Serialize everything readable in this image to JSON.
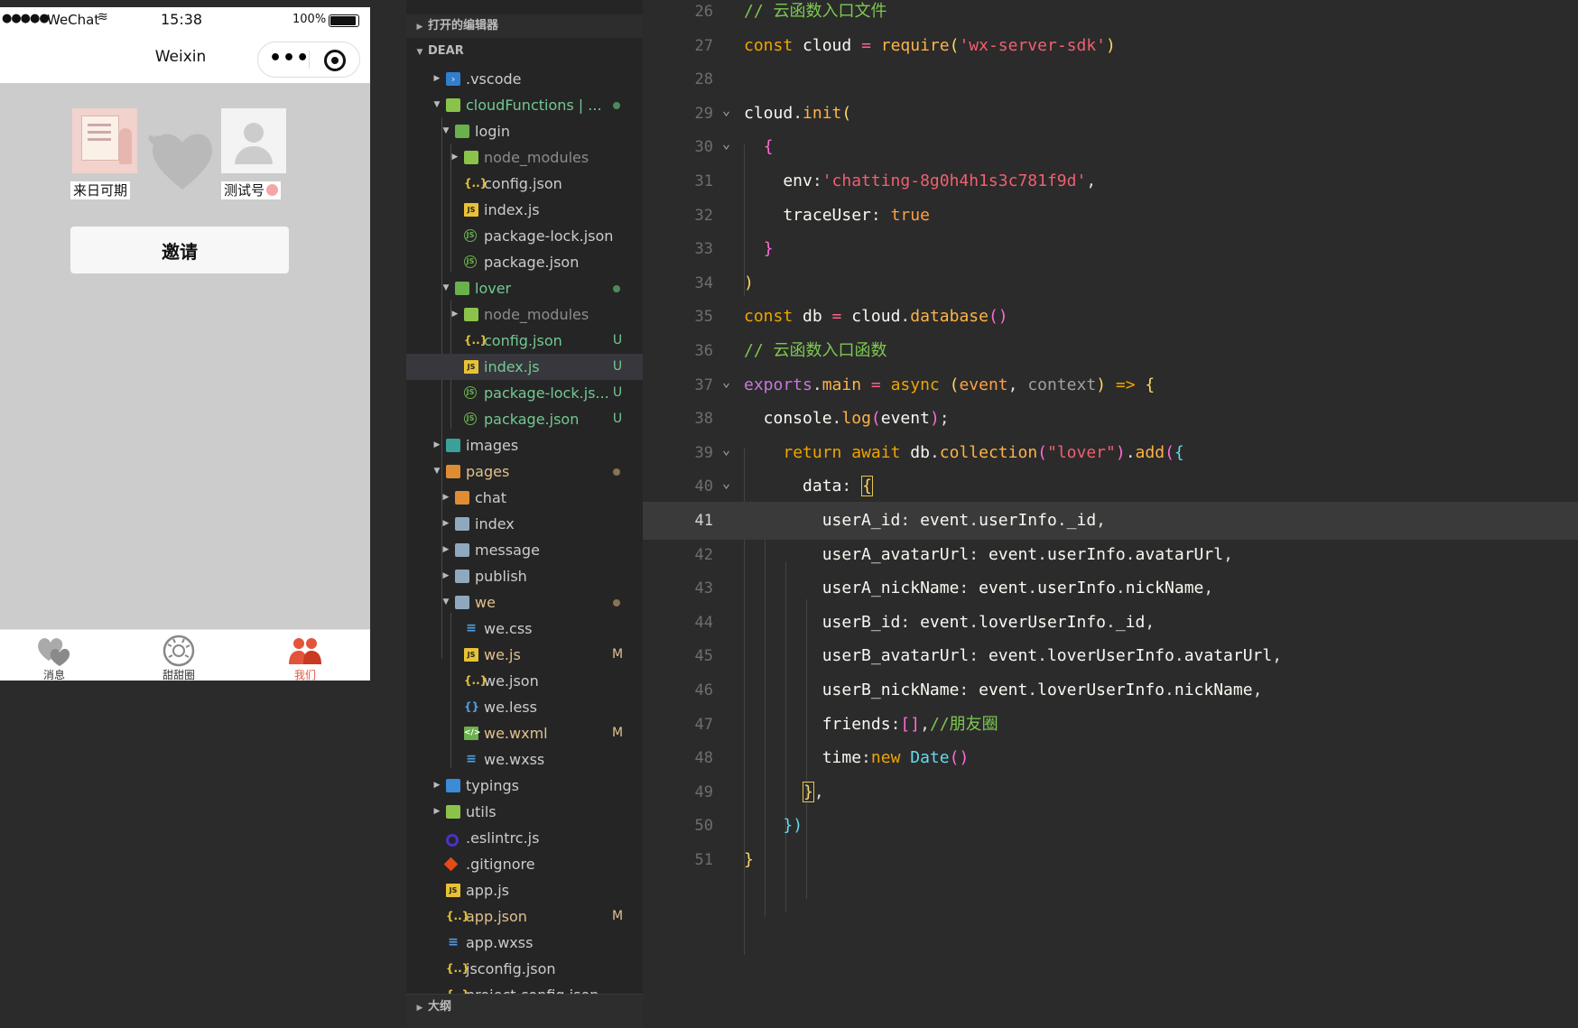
{
  "phone": {
    "status": {
      "signal": "●●●●●",
      "carrier": "WeChat",
      "wifi": "≋",
      "time": "15:38",
      "battery": "100%"
    },
    "nav_title": "Weixin",
    "capsule_dots": "•••",
    "user1_name": "来日可期",
    "user2_name": "测试号",
    "invite_label": "邀请",
    "tabs": [
      {
        "label": "消息",
        "icon": "hearts-icon"
      },
      {
        "label": "甜甜圈",
        "icon": "donut-icon"
      },
      {
        "label": "我们",
        "icon": "couple-icon"
      }
    ],
    "accent": "#e2553b"
  },
  "explorer": {
    "open_editors": "打开的编辑器",
    "workspace": "DEAR",
    "outline": "大纲",
    "rows": [
      {
        "name": ".vscode",
        "status": ""
      },
      {
        "name": "cloudFunctions | ...",
        "status": "●"
      },
      {
        "name": "login",
        "status": ""
      },
      {
        "name": "node_modules",
        "status": ""
      },
      {
        "name": "config.json",
        "status": ""
      },
      {
        "name": "index.js",
        "status": ""
      },
      {
        "name": "package-lock.json",
        "status": ""
      },
      {
        "name": "package.json",
        "status": ""
      },
      {
        "name": "lover",
        "status": "●"
      },
      {
        "name": "node_modules",
        "status": ""
      },
      {
        "name": "config.json",
        "status": "U"
      },
      {
        "name": "index.js",
        "status": "U"
      },
      {
        "name": "package-lock.js...",
        "status": "U"
      },
      {
        "name": "package.json",
        "status": "U"
      },
      {
        "name": "images",
        "status": ""
      },
      {
        "name": "pages",
        "status": "●"
      },
      {
        "name": "chat",
        "status": ""
      },
      {
        "name": "index",
        "status": ""
      },
      {
        "name": "message",
        "status": ""
      },
      {
        "name": "publish",
        "status": ""
      },
      {
        "name": "we",
        "status": "●"
      },
      {
        "name": "we.css",
        "status": ""
      },
      {
        "name": "we.js",
        "status": "M"
      },
      {
        "name": "we.json",
        "status": ""
      },
      {
        "name": "we.less",
        "status": ""
      },
      {
        "name": "we.wxml",
        "status": "M"
      },
      {
        "name": "we.wxss",
        "status": ""
      },
      {
        "name": "typings",
        "status": ""
      },
      {
        "name": "utils",
        "status": ""
      },
      {
        "name": ".eslintrc.js",
        "status": ""
      },
      {
        "name": ".gitignore",
        "status": ""
      },
      {
        "name": "app.js",
        "status": ""
      },
      {
        "name": "app.json",
        "status": "M"
      },
      {
        "name": "app.wxss",
        "status": ""
      },
      {
        "name": "jsconfig.json",
        "status": ""
      },
      {
        "name": "project.config.json",
        "status": ""
      }
    ]
  },
  "editor": {
    "current_line": "41",
    "lines": [
      {
        "n": "26",
        "t": [
          [
            "c",
            "// 云函数入口文件"
          ]
        ]
      },
      {
        "n": "27",
        "t": [
          [
            "k",
            "const "
          ],
          [
            "w",
            "cloud "
          ],
          [
            "b",
            "= "
          ],
          [
            "f",
            "require"
          ],
          [
            "p",
            "("
          ],
          [
            "s",
            "'wx-server-sdk'"
          ],
          [
            "p",
            ")"
          ]
        ]
      },
      {
        "n": "28",
        "t": []
      },
      {
        "n": "29",
        "t": [
          [
            "w",
            "cloud"
          ],
          [
            "m",
            "."
          ],
          [
            "f",
            "init"
          ],
          [
            "p",
            "("
          ]
        ]
      },
      {
        "n": "30",
        "t": [
          [
            "w",
            "  "
          ],
          [
            "mg",
            "{"
          ]
        ]
      },
      {
        "n": "31",
        "t": [
          [
            "w",
            "    env"
          ],
          [
            "m",
            ":"
          ],
          [
            "s",
            "'chatting-8g0h4h1s3c781f9d'"
          ],
          [
            "m",
            ","
          ]
        ]
      },
      {
        "n": "32",
        "t": [
          [
            "w",
            "    traceUser"
          ],
          [
            "m",
            ": "
          ],
          [
            "t",
            "true"
          ]
        ]
      },
      {
        "n": "33",
        "t": [
          [
            "w",
            "  "
          ],
          [
            "mg",
            "}"
          ]
        ]
      },
      {
        "n": "34",
        "t": [
          [
            "p",
            ")"
          ]
        ]
      },
      {
        "n": "35",
        "t": [
          [
            "k",
            "const "
          ],
          [
            "w",
            "db "
          ],
          [
            "b",
            "= "
          ],
          [
            "w",
            "cloud"
          ],
          [
            "m",
            "."
          ],
          [
            "f",
            "database"
          ],
          [
            "mg",
            "()"
          ]
        ]
      },
      {
        "n": "36",
        "t": [
          [
            "c",
            "// 云函数入口函数"
          ]
        ]
      },
      {
        "n": "37",
        "t": [
          [
            "kp",
            "exports"
          ],
          [
            "m",
            "."
          ],
          [
            "f",
            "main "
          ],
          [
            "b",
            "= "
          ],
          [
            "k",
            "async "
          ],
          [
            "p",
            "("
          ],
          [
            "t",
            "event"
          ],
          [
            "m",
            ", "
          ],
          [
            "par",
            "context"
          ],
          [
            "p",
            ") "
          ],
          [
            "k",
            "=> "
          ],
          [
            "p",
            "{"
          ]
        ]
      },
      {
        "n": "38",
        "t": [
          [
            "w",
            "  console"
          ],
          [
            "m",
            "."
          ],
          [
            "f",
            "log"
          ],
          [
            "mg",
            "("
          ],
          [
            "w",
            "event"
          ],
          [
            "mg",
            ")"
          ],
          [
            "m",
            ";"
          ]
        ]
      },
      {
        "n": "39",
        "t": [
          [
            "w",
            "    "
          ],
          [
            "k",
            "return await "
          ],
          [
            "w",
            "db"
          ],
          [
            "m",
            "."
          ],
          [
            "f",
            "collection"
          ],
          [
            "mg",
            "("
          ],
          [
            "s",
            "\"lover\""
          ],
          [
            "mg",
            ")"
          ],
          [
            "m",
            "."
          ],
          [
            "f",
            "add"
          ],
          [
            "mg",
            "("
          ],
          [
            "bl",
            "{"
          ]
        ]
      },
      {
        "n": "40",
        "t": [
          [
            "w",
            "      data"
          ],
          [
            "m",
            ": "
          ],
          [
            "p",
            "{"
          ]
        ]
      },
      {
        "n": "41",
        "t": [
          [
            "w",
            "        userA_id"
          ],
          [
            "m",
            ": "
          ],
          [
            "w",
            "event"
          ],
          [
            "m",
            "."
          ],
          [
            "w",
            "userInfo"
          ],
          [
            "m",
            "."
          ],
          [
            "w",
            "_id"
          ],
          [
            "m",
            ","
          ]
        ]
      },
      {
        "n": "42",
        "t": [
          [
            "w",
            "        userA_avatarUrl"
          ],
          [
            "m",
            ": "
          ],
          [
            "w",
            "event"
          ],
          [
            "m",
            "."
          ],
          [
            "w",
            "userInfo"
          ],
          [
            "m",
            "."
          ],
          [
            "w",
            "avatarUrl"
          ],
          [
            "m",
            ","
          ]
        ]
      },
      {
        "n": "43",
        "t": [
          [
            "w",
            "        userA_nickName"
          ],
          [
            "m",
            ": "
          ],
          [
            "w",
            "event"
          ],
          [
            "m",
            "."
          ],
          [
            "w",
            "userInfo"
          ],
          [
            "m",
            "."
          ],
          [
            "w",
            "nickName"
          ],
          [
            "m",
            ","
          ]
        ]
      },
      {
        "n": "44",
        "t": [
          [
            "w",
            "        userB_id"
          ],
          [
            "m",
            ": "
          ],
          [
            "w",
            "event"
          ],
          [
            "m",
            "."
          ],
          [
            "w",
            "loverUserInfo"
          ],
          [
            "m",
            "."
          ],
          [
            "w",
            "_id"
          ],
          [
            "m",
            ","
          ]
        ]
      },
      {
        "n": "45",
        "t": [
          [
            "w",
            "        userB_avatarUrl"
          ],
          [
            "m",
            ": "
          ],
          [
            "w",
            "event"
          ],
          [
            "m",
            "."
          ],
          [
            "w",
            "loverUserInfo"
          ],
          [
            "m",
            "."
          ],
          [
            "w",
            "avatarUrl"
          ],
          [
            "m",
            ","
          ]
        ]
      },
      {
        "n": "46",
        "t": [
          [
            "w",
            "        userB_nickName"
          ],
          [
            "m",
            ": "
          ],
          [
            "w",
            "event"
          ],
          [
            "m",
            "."
          ],
          [
            "w",
            "loverUserInfo"
          ],
          [
            "m",
            "."
          ],
          [
            "w",
            "nickName"
          ],
          [
            "m",
            ","
          ]
        ]
      },
      {
        "n": "47",
        "t": [
          [
            "w",
            "        friends"
          ],
          [
            "m",
            ":"
          ],
          [
            "mg",
            "[]"
          ],
          [
            "m",
            ","
          ],
          [
            "c",
            "//朋友圈"
          ]
        ]
      },
      {
        "n": "48",
        "t": [
          [
            "w",
            "        time"
          ],
          [
            "m",
            ":"
          ],
          [
            "k",
            "new "
          ],
          [
            "bl",
            "Date"
          ],
          [
            "mg",
            "()"
          ]
        ]
      },
      {
        "n": "49",
        "t": [
          [
            "w",
            "      "
          ],
          [
            "p",
            "}"
          ],
          [
            "m",
            ","
          ]
        ]
      },
      {
        "n": "50",
        "t": [
          [
            "w",
            "    "
          ],
          [
            "bl",
            "})"
          ]
        ]
      },
      {
        "n": "51",
        "t": [
          [
            "p",
            "}"
          ]
        ]
      }
    ]
  }
}
